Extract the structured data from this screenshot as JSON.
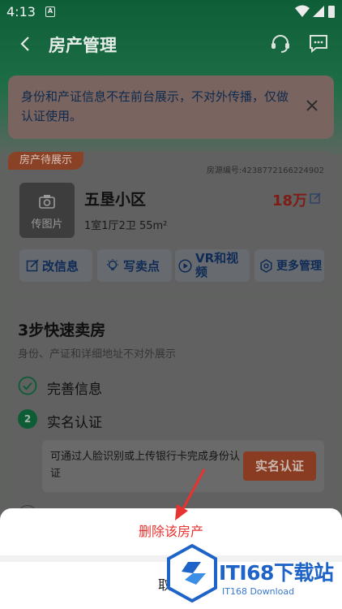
{
  "status": {
    "time": "4:13",
    "notification_letter": "A"
  },
  "header": {
    "title": "房产管理"
  },
  "notice": {
    "text": "身份和产证信息不在前台展示，不对外传播，仅做认证使用。"
  },
  "property": {
    "tag": "房产待展示",
    "house_no": "房源编号:4238772166224902",
    "photo_label": "传图片",
    "name": "五垦小区",
    "info": "1室1厅2卫 55m²",
    "price": "18万",
    "actions": [
      {
        "label": "改信息",
        "icon": "edit-icon"
      },
      {
        "label": "写卖点",
        "icon": "bulb-icon"
      },
      {
        "label": "VR和视频",
        "icon": "play-icon"
      },
      {
        "label": "更多管理",
        "icon": "gear-icon"
      }
    ]
  },
  "steps": {
    "title": "3步快速卖房",
    "subtitle": "身份、产证和详细地址不对外展示",
    "items": [
      {
        "label": "完善信息",
        "status": "done"
      },
      {
        "number": "2",
        "label": "实名认证",
        "status": "current"
      }
    ],
    "verify_desc": "可通过人脸识别或上传银行卡完成身份认证",
    "verify_button": "实名认证"
  },
  "sheet": {
    "delete_label": "删除该房产",
    "cancel_label": "取消"
  },
  "watermark": {
    "title": "ITI68下载站",
    "subtitle": "IT168 Download"
  },
  "colors": {
    "delete_red": "#e8322f",
    "brand_green": "#0e5e38",
    "watermark_blue": "#1e63c8"
  }
}
